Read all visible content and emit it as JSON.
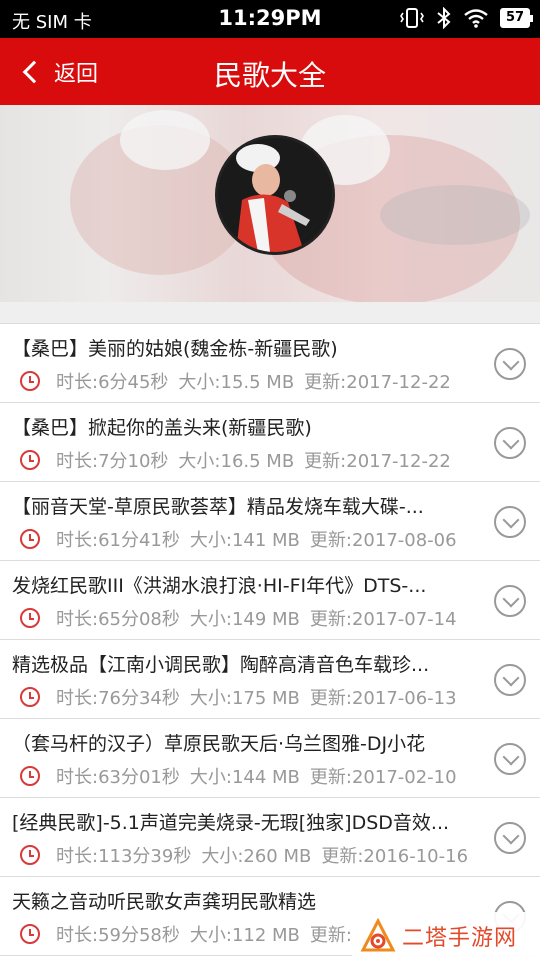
{
  "status_bar": {
    "carrier": "无 SIM 卡",
    "time": "11:29PM",
    "battery": "57"
  },
  "app_bar": {
    "back_label": "返回",
    "title": "民歌大全"
  },
  "songs": [
    {
      "title": "【桑巴】美丽的姑娘(魏金栋-新疆民歌)",
      "duration": "时长:6分45秒",
      "size": "大小:15.5 MB",
      "updated": "更新:2017-12-22"
    },
    {
      "title": "【桑巴】掀起你的盖头来(新疆民歌)",
      "duration": "时长:7分10秒",
      "size": "大小:16.5 MB",
      "updated": "更新:2017-12-22"
    },
    {
      "title": "【丽音天堂-草原民歌荟萃】精品发烧车载大碟-...",
      "duration": "时长:61分41秒",
      "size": "大小:141 MB",
      "updated": "更新:2017-08-06"
    },
    {
      "title": "发烧红民歌III《洪湖水浪打浪·HI-FI年代》DTS-...",
      "duration": "时长:65分08秒",
      "size": "大小:149 MB",
      "updated": "更新:2017-07-14"
    },
    {
      "title": "精选极品【江南小调民歌】陶醉高清音色车载珍...",
      "duration": "时长:76分34秒",
      "size": "大小:175 MB",
      "updated": "更新:2017-06-13"
    },
    {
      "title": "（套马杆的汉子）草原民歌天后·乌兰图雅-DJ小花",
      "duration": "时长:63分01秒",
      "size": "大小:144 MB",
      "updated": "更新:2017-02-10"
    },
    {
      "title": "[经典民歌]-5.1声道完美烧录-无瑕[独家]DSD音效...",
      "duration": "时长:113分39秒",
      "size": "大小:260 MB",
      "updated": "更新:2016-10-16"
    },
    {
      "title": "天籁之音动听民歌女声龚玥民歌精选",
      "duration": "时长:59分58秒",
      "size": "大小:112 MB",
      "updated": "更新:"
    }
  ],
  "watermark": {
    "text": "二塔手游网"
  },
  "colors": {
    "accent": "#d80c0c",
    "clock_icon": "#d83a3a",
    "meta_text": "#999999"
  }
}
